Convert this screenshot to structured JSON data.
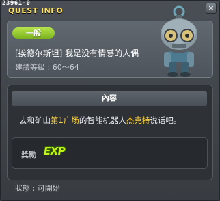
{
  "window": {
    "quest_id": "23961-0",
    "title": "QUEST INFO",
    "close_label": "×"
  },
  "summary": {
    "badge": "一般",
    "npc_title": "[挨德尔斯坦] 我是没有情感的人偶",
    "level_text": "建議等級 : 60～64"
  },
  "details": {
    "section_title": "內容",
    "description_parts": {
      "p1": "去和矿山",
      "place": "第1广场",
      "p2": "的智能机器人",
      "npc": "杰克特",
      "p3": "说话吧。"
    }
  },
  "reward": {
    "label": "獎勵",
    "exp_text": "EXP"
  },
  "status_text": "狀態 : 可開始",
  "colors": {
    "title": "#ffe36b",
    "badge": "#8ec52a",
    "highlight": "#ffd33a",
    "exp": "#c9f21a"
  },
  "icons": {
    "npc": "robot-npc-portrait",
    "close": "close-icon"
  }
}
